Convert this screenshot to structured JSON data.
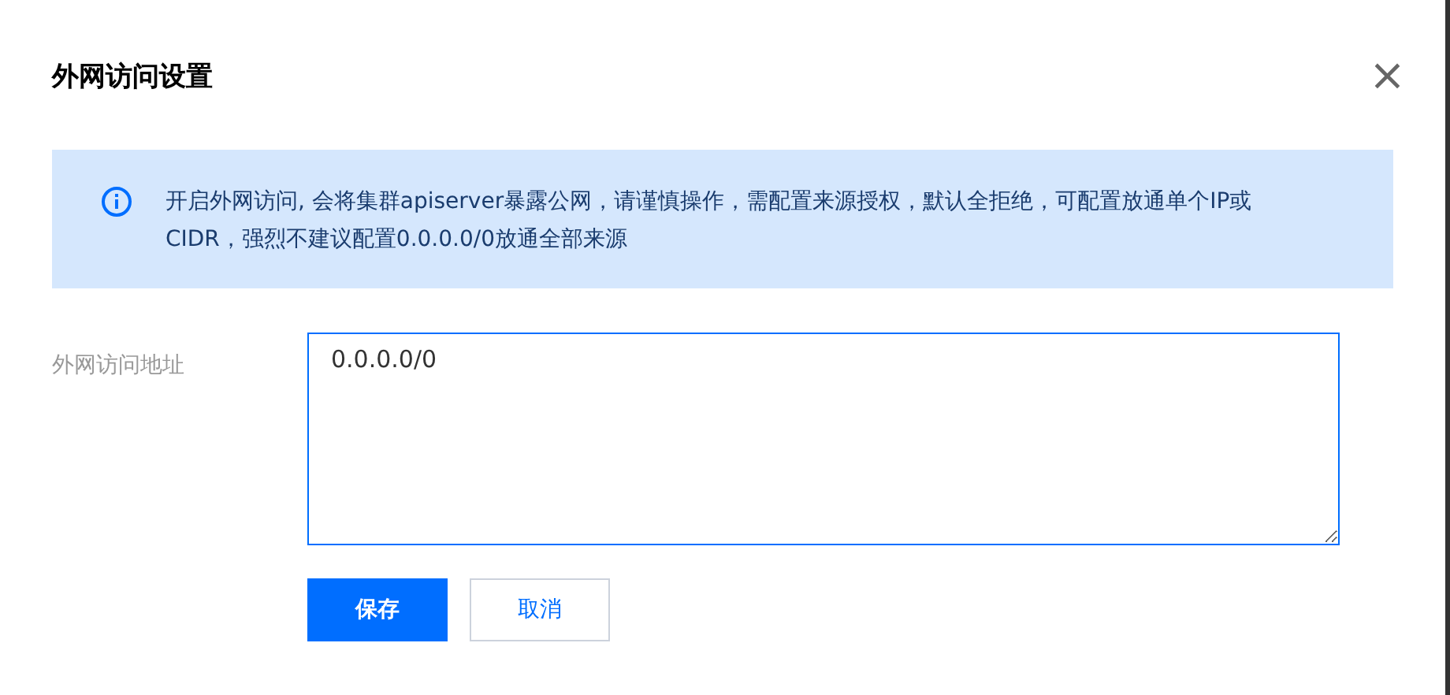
{
  "dialog": {
    "title": "外网访问设置",
    "close": "×"
  },
  "notice": {
    "text": "开启外网访问, 会将集群apiserver暴露公网，请谨慎操作，需配置来源授权，默认全拒绝，可配置放通单个IP或CIDR，强烈不建议配置0.0.0.0/0放通全部来源"
  },
  "form": {
    "label": "外网访问地址",
    "value": "0.0.0.0/0"
  },
  "buttons": [
    {
      "label": "保存",
      "kind": "primary"
    },
    {
      "label": "取消",
      "kind": "secondary"
    }
  ]
}
